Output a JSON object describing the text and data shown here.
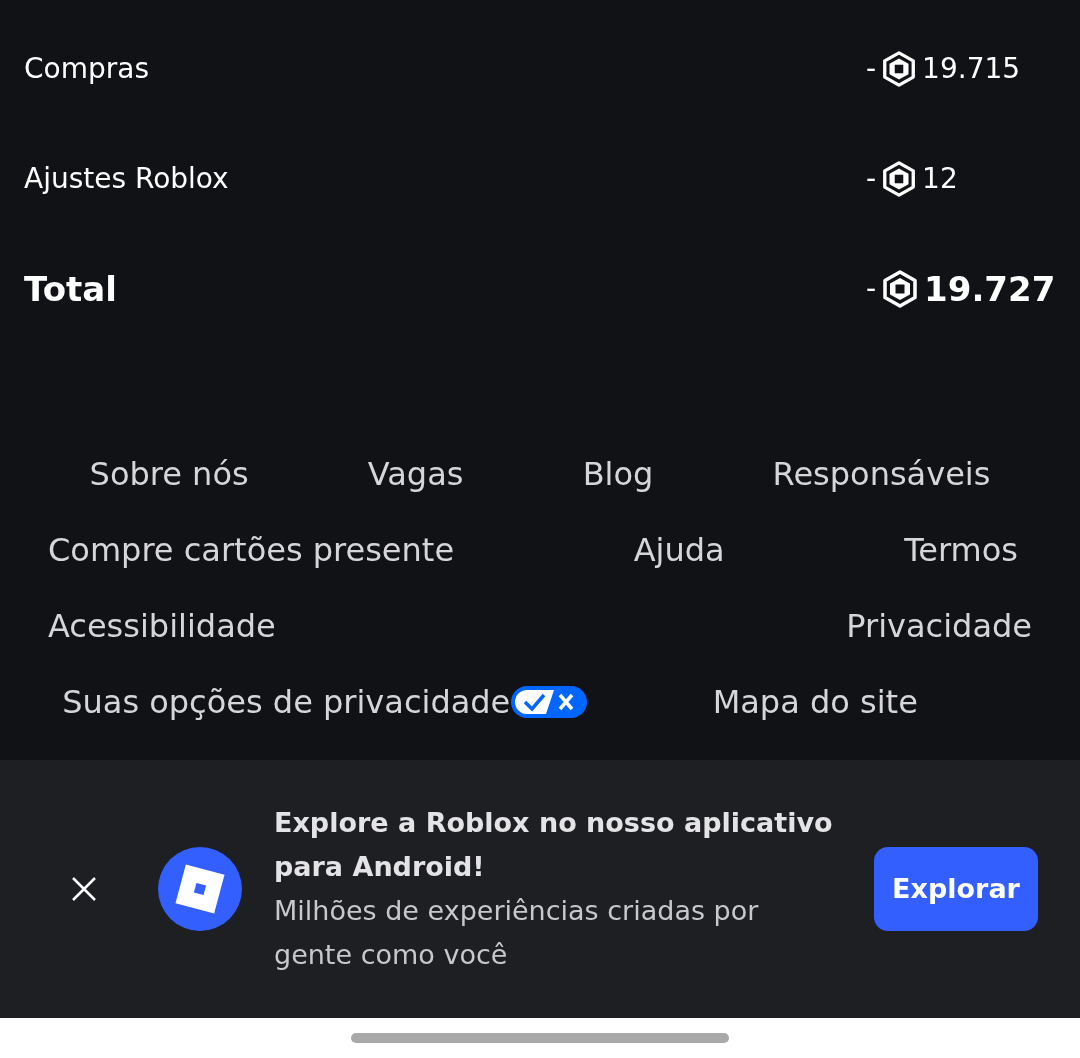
{
  "summary": [
    {
      "label": "Compras",
      "sign": "-",
      "amount": "19.715",
      "kind": "item"
    },
    {
      "label": "Ajustes Roblox",
      "sign": "-",
      "amount": "12",
      "kind": "item"
    },
    {
      "label": "Total",
      "sign": "-",
      "amount": "19.727",
      "kind": "total"
    }
  ],
  "footer_rows": [
    [
      {
        "label": "Sobre nós",
        "kind": "link"
      },
      {
        "label": "Vagas",
        "kind": "link"
      },
      {
        "label": "Blog",
        "kind": "link"
      },
      {
        "label": "Responsáveis",
        "kind": "link"
      }
    ],
    [
      {
        "label": "Compre cartões presente",
        "kind": "link"
      },
      {
        "label": "Ajuda",
        "kind": "link"
      },
      {
        "label": "Termos",
        "kind": "link"
      }
    ],
    [
      {
        "label": "Acessibilidade",
        "kind": "link"
      },
      {
        "label": "Privacidade",
        "kind": "link"
      }
    ],
    [
      {
        "label": "Suas opções de privacidade",
        "kind": "privacy-choices"
      },
      {
        "label": "Mapa do site",
        "kind": "link"
      }
    ]
  ],
  "app_banner": {
    "title": "Explore a Roblox no nosso aplicativo para Android!",
    "subtitle": "Milhões de experiências criadas por gente como você",
    "button": "Explorar"
  }
}
